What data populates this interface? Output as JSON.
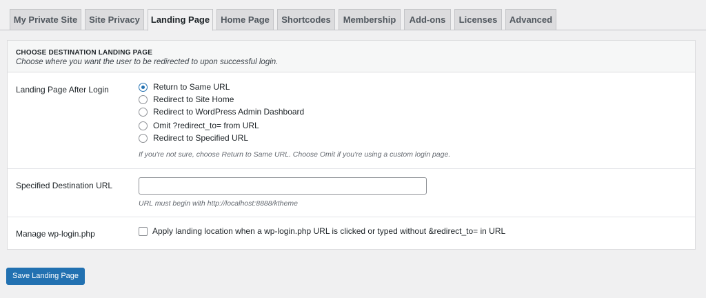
{
  "tabs": [
    {
      "label": "My Private Site",
      "active": false
    },
    {
      "label": "Site Privacy",
      "active": false
    },
    {
      "label": "Landing Page",
      "active": true
    },
    {
      "label": "Home Page",
      "active": false
    },
    {
      "label": "Shortcodes",
      "active": false
    },
    {
      "label": "Membership",
      "active": false
    },
    {
      "label": "Add-ons",
      "active": false
    },
    {
      "label": "Licenses",
      "active": false
    },
    {
      "label": "Advanced",
      "active": false
    }
  ],
  "section": {
    "title": "CHOOSE DESTINATION LANDING PAGE",
    "subtitle": "Choose where you want the user to be redirected to upon successful login."
  },
  "landing": {
    "label": "Landing Page After Login",
    "options": [
      {
        "label": "Return to Same URL",
        "checked": true
      },
      {
        "label": "Redirect to Site Home",
        "checked": false
      },
      {
        "label": "Redirect to WordPress Admin Dashboard",
        "checked": false
      },
      {
        "label": "Omit ?redirect_to= from URL",
        "checked": false
      },
      {
        "label": "Redirect to Specified URL",
        "checked": false
      }
    ],
    "hint": "If you're not sure, choose Return to Same URL. Choose Omit if you're using a custom login page."
  },
  "destination": {
    "label": "Specified Destination URL",
    "value": "",
    "hint": "URL must begin with http://localhost:8888/ktheme"
  },
  "wplogin": {
    "label": "Manage wp-login.php",
    "checkbox_label": "Apply landing location when a wp-login.php URL is clicked or typed without &redirect_to= in URL",
    "checked": false
  },
  "save_label": "Save Landing Page",
  "colors": {
    "accent": "#2271b1",
    "background": "#f0f0f1"
  }
}
